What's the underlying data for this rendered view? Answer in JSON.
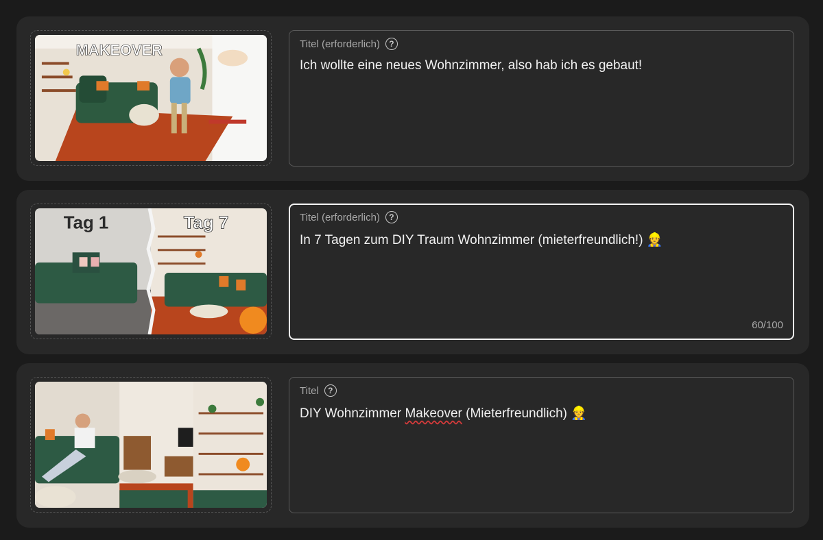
{
  "items": [
    {
      "thumbnail": {
        "overlay_text": "MAKEOVER"
      },
      "title_field": {
        "label": "Titel (erforderlich)",
        "value": "Ich wollte eine neues Wohnzimmer, also hab ich es gebaut!",
        "counter": ""
      }
    },
    {
      "thumbnail": {
        "overlay_left": "Tag 1",
        "overlay_right": "Tag 7"
      },
      "title_field": {
        "label": "Titel (erforderlich)",
        "value": "In 7 Tagen zum DIY Traum Wohnzimmer (mieterfreundlich!) 👷",
        "counter": "60/100"
      }
    },
    {
      "thumbnail": {},
      "title_field": {
        "label": "Titel",
        "value_prefix": "DIY Wohnzimmer ",
        "value_misspelled": "Makeover",
        "value_suffix": " (Mieterfreundlich) 👷",
        "counter": ""
      }
    }
  ],
  "icons": {
    "help": "help-circle-icon"
  },
  "colors": {
    "background": "#1b1b1b",
    "card": "#282828",
    "focus_border": "#f4f4f4",
    "spellcheck": "#d03a3a"
  }
}
